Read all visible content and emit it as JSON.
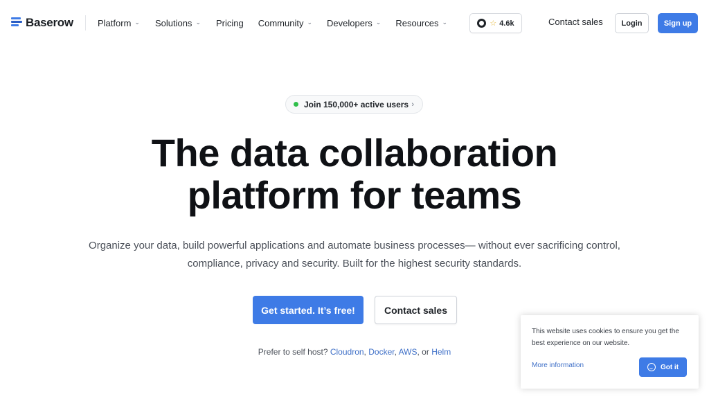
{
  "brand": {
    "name": "Baserow",
    "logo_icon": "baserow-logo-icon",
    "accent": "#3e7be6"
  },
  "nav": {
    "items": [
      {
        "label": "Platform",
        "has_dropdown": true
      },
      {
        "label": "Solutions",
        "has_dropdown": true
      },
      {
        "label": "Pricing",
        "has_dropdown": false
      },
      {
        "label": "Community",
        "has_dropdown": true
      },
      {
        "label": "Developers",
        "has_dropdown": true
      },
      {
        "label": "Resources",
        "has_dropdown": true
      }
    ],
    "github_stars": "4.6k",
    "contact_sales": "Contact sales",
    "login": "Login",
    "signup": "Sign up"
  },
  "hero": {
    "users_pill": "Join 150,000+ active users",
    "title_line1": "The data collaboration",
    "title_line2": "platform for teams",
    "subtitle": "Organize your data, build powerful applications and automate business processes— without ever sacrificing control, compliance, privacy and security. Built for the highest security standards.",
    "cta_primary": "Get started. It’s free!",
    "cta_secondary": "Contact sales",
    "selfhost_prefix": "Prefer to self host?",
    "selfhost_links": [
      "Cloudron",
      "Docker",
      "AWS",
      "Helm"
    ],
    "selfhost_sep": ",",
    "selfhost_or": ", or"
  },
  "cookie": {
    "message": "This website uses cookies to ensure you get the best experience on our website.",
    "more_info": "More information",
    "accept": "Got it"
  }
}
